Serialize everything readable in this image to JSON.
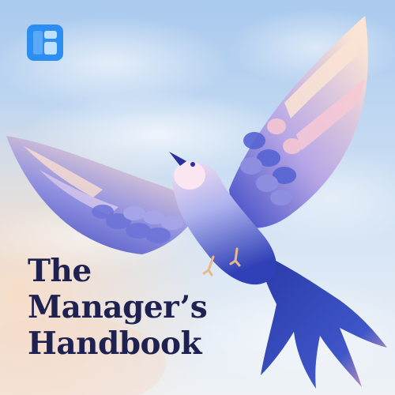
{
  "cover": {
    "logo_icon": "logo-icon",
    "bird_illustration": "bird-illustration",
    "title_lines": [
      "The",
      "Manager’s",
      "Handbook"
    ]
  },
  "colors": {
    "sky_top": "#b7d3f0",
    "sky_bottom": "#e8eff6",
    "peach_glow": "#f6dcc8",
    "logo_blue": "#2b8ef0",
    "logo_light": "#9fd0ff",
    "bird_blue": "#3e4fc8",
    "bird_deep": "#2a2f9e",
    "feather_pink": "#f4c6d2",
    "feather_peach": "#fbe2cf",
    "title_navy": "#1f2150"
  }
}
